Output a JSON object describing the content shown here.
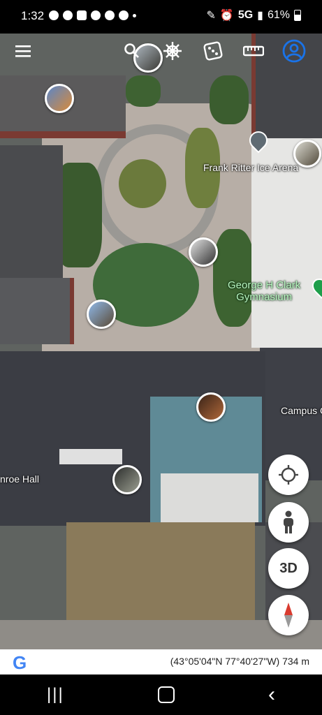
{
  "status_bar": {
    "time": "1:32",
    "network": "5G",
    "battery": "61%"
  },
  "toolbar": {
    "menu_icon": "menu-icon",
    "search_icon": "search-icon",
    "voyager_icon": "ship-wheel-icon",
    "feeling_lucky_icon": "dice-icon",
    "measure_icon": "ruler-icon",
    "account_icon": "account-icon"
  },
  "map": {
    "labels": {
      "ice_arena": "Frank Ritter Ice Arena",
      "gymnasium": "George H Clark\nGymnasium",
      "campus": "Campus C",
      "hall": "nroe Hall"
    }
  },
  "controls": {
    "three_d_label": "3D"
  },
  "info_bar": {
    "coordinates": "(43°05'04\"N 77°40'27\"W) 734 m",
    "logo": "G"
  }
}
